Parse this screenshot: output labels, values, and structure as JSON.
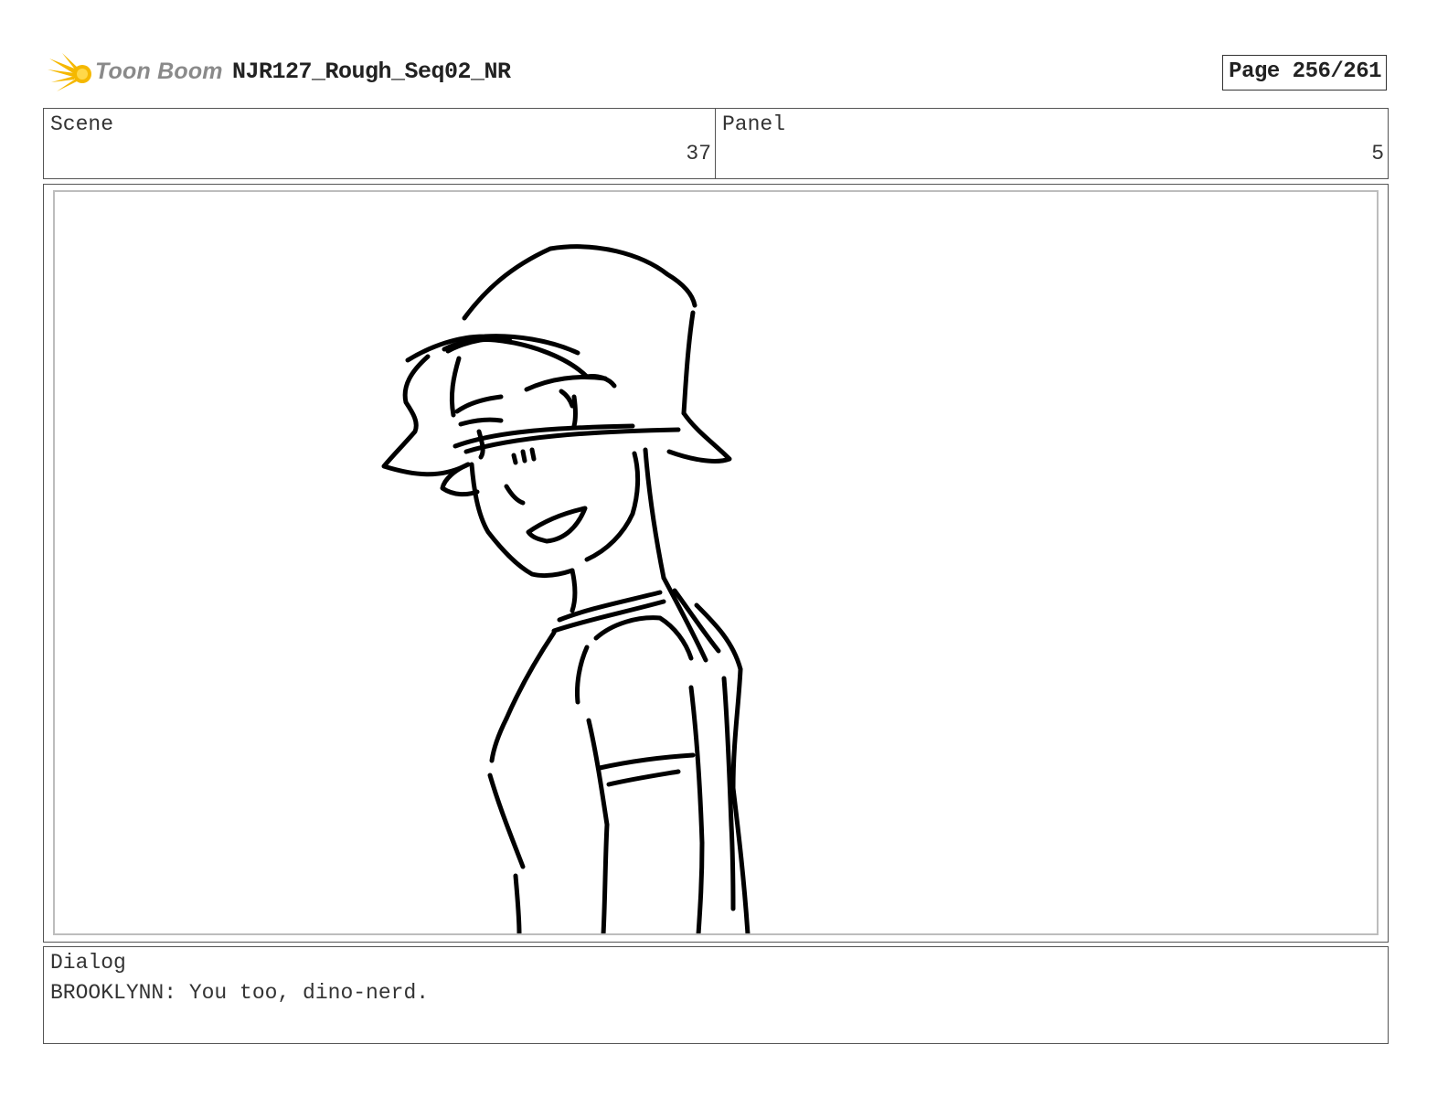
{
  "header": {
    "logo_text": "Toon Boom",
    "project_title": "NJR127_Rough_Seq02_NR",
    "page_label": "Page 256/261"
  },
  "scene": {
    "label": "Scene",
    "value": "37"
  },
  "panel": {
    "label": "Panel",
    "value": "5"
  },
  "dialog": {
    "label": "Dialog",
    "text": "BROOKLYNN: You too, dino-nerd."
  },
  "colors": {
    "logo_star": "#f5b800",
    "logo_text": "#8a8a8a",
    "frame_inner_border": "#bdbdbd",
    "sketch_line": "#000000"
  }
}
